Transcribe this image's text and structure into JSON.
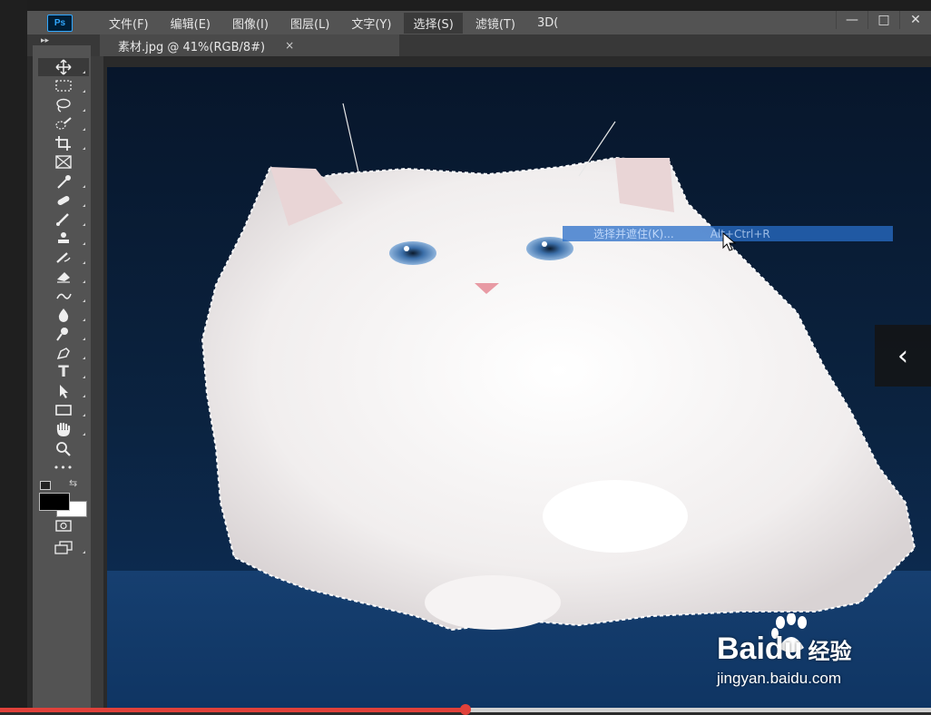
{
  "app": {
    "logo_text": "Ps",
    "menus": [
      "文件(F)",
      "编辑(E)",
      "图像(I)",
      "图层(L)",
      "文字(Y)",
      "选择(S)",
      "滤镜(T)",
      "3D("
    ],
    "active_menu_index": 5,
    "window_buttons": [
      "—",
      "□",
      "✕"
    ]
  },
  "tabs": {
    "collapse_glyph": "▸▸",
    "document_title": "素材.jpg @ 41%(RGB/8#)",
    "close_glyph": "×"
  },
  "toolbar": {
    "tools": [
      {
        "name": "move-tool",
        "icon": "move-icon",
        "selected": true
      },
      {
        "name": "marquee-tool",
        "icon": "marquee-icon"
      },
      {
        "name": "lasso-tool",
        "icon": "lasso-icon"
      },
      {
        "name": "quick-selection-tool",
        "icon": "quick-selection-icon"
      },
      {
        "name": "crop-tool",
        "icon": "crop-icon"
      },
      {
        "name": "frame-tool",
        "icon": "frame-icon"
      },
      {
        "name": "eyedropper-tool",
        "icon": "eyedropper-icon"
      },
      {
        "name": "healing-brush-tool",
        "icon": "bandage-icon"
      },
      {
        "name": "brush-tool",
        "icon": "brush-icon"
      },
      {
        "name": "clone-stamp-tool",
        "icon": "stamp-icon"
      },
      {
        "name": "history-brush-tool",
        "icon": "history-brush-icon"
      },
      {
        "name": "eraser-tool",
        "icon": "eraser-icon"
      },
      {
        "name": "gradient-tool",
        "icon": "gradient-icon"
      },
      {
        "name": "blur-tool",
        "icon": "drop-icon"
      },
      {
        "name": "dodge-tool",
        "icon": "dodge-icon"
      },
      {
        "name": "pen-tool",
        "icon": "pen-icon"
      },
      {
        "name": "type-tool",
        "icon": "type-icon",
        "glyph": "T"
      },
      {
        "name": "path-selection-tool",
        "icon": "arrow-icon"
      },
      {
        "name": "rectangle-tool",
        "icon": "rectangle-icon"
      },
      {
        "name": "hand-tool",
        "icon": "hand-icon"
      },
      {
        "name": "zoom-tool",
        "icon": "zoom-icon"
      },
      {
        "name": "more-tools",
        "icon": "more-icon",
        "glyph": "•••"
      }
    ],
    "foreground_color": "#000000",
    "background_color": "#ffffff"
  },
  "context_menu": {
    "highlighted_label": "选择并遮住(K)...",
    "highlighted_shortcut": "Alt+Ctrl+R"
  },
  "overlay": {
    "side_nav_glyph": "‹"
  },
  "watermark": {
    "brand": "Bai",
    "brand_suffix": "du",
    "product": "经验",
    "url": "jingyan.baidu.com"
  },
  "video_progress": {
    "fraction": 0.5
  },
  "colors": {
    "accent_blue": "#31a8ff",
    "progress_red": "#e0413a",
    "panel": "#535353",
    "selection_highlight": "#286ec8"
  }
}
